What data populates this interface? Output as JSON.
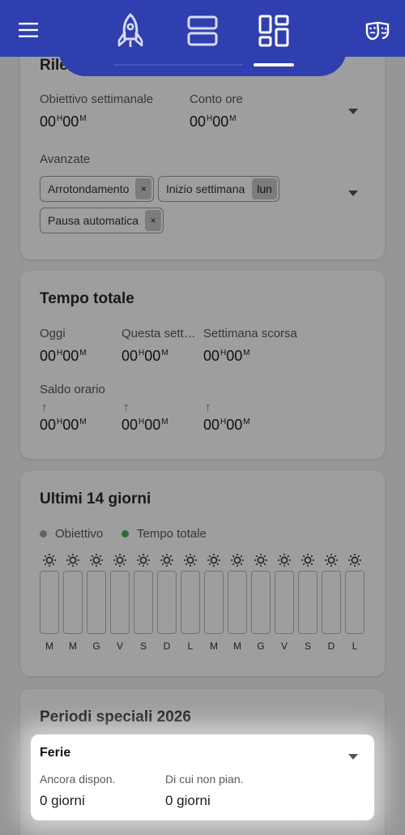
{
  "topbar": {
    "menu_icon": "hamburger-menu-icon",
    "tabs": [
      {
        "icon": "rocket-icon",
        "selected": false
      },
      {
        "icon": "two-rows-icon",
        "selected": false
      },
      {
        "icon": "dashboard-grid-icon",
        "selected": true
      }
    ],
    "right_icon": "theater-masks-icon"
  },
  "settings_card": {
    "title": "Rile",
    "weekly_goal_label": "Obiettivo settimanale",
    "weekly_goal_value": {
      "h": "00",
      "m": "00"
    },
    "hours_account_label": "Conto ore",
    "hours_account_value": {
      "h": "00",
      "m": "00"
    },
    "advanced_label": "Avanzate",
    "chips": [
      {
        "label": "Arrotondamento",
        "action": "×"
      },
      {
        "label": "Inizio settimana",
        "value": "lun"
      },
      {
        "label": "Pausa automatica",
        "action": "×"
      }
    ]
  },
  "total_card": {
    "title": "Tempo totale",
    "today_label": "Oggi",
    "this_week_label": "Questa sett…",
    "last_week_label": "Settimana scorsa",
    "today_value": {
      "h": "00",
      "m": "00"
    },
    "this_week_value": {
      "h": "00",
      "m": "00"
    },
    "last_week_value": {
      "h": "00",
      "m": "00"
    },
    "balance_label": "Saldo orario",
    "balance_values": [
      {
        "h": "00",
        "m": "00",
        "arrow": "↑"
      },
      {
        "h": "00",
        "m": "00",
        "arrow": "↑"
      },
      {
        "h": "00",
        "m": "00",
        "arrow": "↑"
      }
    ]
  },
  "last14_card": {
    "title": "Ultimi 14 giorni",
    "legend": [
      {
        "label": "Obiettivo",
        "color": "#9e9e9e"
      },
      {
        "label": "Tempo totale",
        "color": "#4caf50"
      }
    ],
    "day_icon": "sun-icon",
    "days": [
      "M",
      "M",
      "G",
      "V",
      "S",
      "D",
      "L",
      "M",
      "M",
      "G",
      "V",
      "S",
      "D",
      "L"
    ],
    "values": [
      0,
      0,
      0,
      0,
      0,
      0,
      0,
      0,
      0,
      0,
      0,
      0,
      0,
      0
    ]
  },
  "special_card": {
    "title": "Periodi speciali 2026"
  },
  "holidays": {
    "title": "Ferie",
    "remaining_label": "Ancora dispon.",
    "remaining_value": "0 giorni",
    "unplanned_label": "Di cui non pian.",
    "unplanned_value": "0 giorni"
  },
  "colors": {
    "primary": "#2f3fb0",
    "positive": "#2e9e5b"
  }
}
